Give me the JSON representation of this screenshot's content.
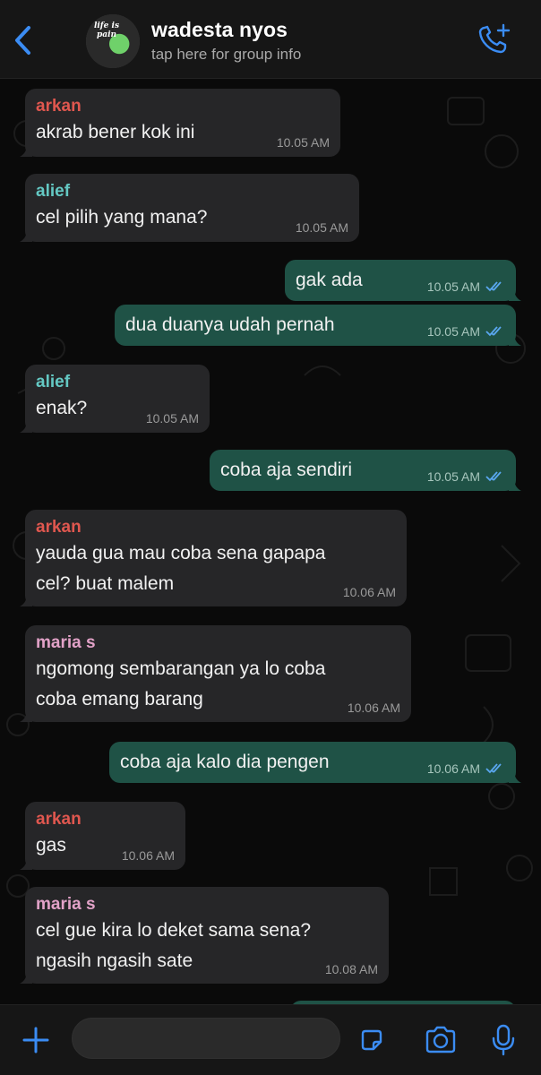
{
  "header": {
    "group_name": "wadesta nyos",
    "subtitle": "tap here for group info",
    "avatar_text": "life is pain",
    "accent": "#3b8cf3"
  },
  "messages": [
    {
      "sender": "arkan",
      "sender_color": "#e0574f",
      "lines": [
        "akrab bener kok ini"
      ],
      "time": "10.05 AM",
      "out": false
    },
    {
      "sender": "alief",
      "sender_color": "#64c8c3",
      "lines": [
        "cel pilih yang mana?"
      ],
      "time": "10.05 AM",
      "out": false
    },
    {
      "sender": "",
      "lines": [
        "gak ada"
      ],
      "time": "10.05 AM",
      "out": true
    },
    {
      "sender": "",
      "lines": [
        "dua duanya udah pernah"
      ],
      "time": "10.05 AM",
      "out": true
    },
    {
      "sender": "alief",
      "sender_color": "#64c8c3",
      "lines": [
        "enak?"
      ],
      "time": "10.05 AM",
      "out": false
    },
    {
      "sender": "",
      "lines": [
        "coba aja sendiri"
      ],
      "time": "10.05 AM",
      "out": true
    },
    {
      "sender": "arkan",
      "sender_color": "#e0574f",
      "lines": [
        "yauda gua mau coba sena gapapa",
        "cel? buat malem"
      ],
      "time": "10.06 AM",
      "out": false
    },
    {
      "sender": "maria s",
      "sender_color": "#e2a2c8",
      "lines": [
        "ngomong sembarangan ya lo coba",
        "coba emang barang"
      ],
      "time": "10.06 AM",
      "out": false
    },
    {
      "sender": "",
      "lines": [
        "coba aja kalo dia pengen"
      ],
      "time": "10.06 AM",
      "out": true
    },
    {
      "sender": "arkan",
      "sender_color": "#e0574f",
      "lines": [
        "gas"
      ],
      "time": "10.06 AM",
      "out": false
    },
    {
      "sender": "maria s",
      "sender_color": "#e2a2c8",
      "lines": [
        "cel gue kira lo deket sama sena?",
        "ngasih ngasih sate"
      ],
      "time": "10.08 AM",
      "out": false
    }
  ],
  "input": {
    "placeholder": ""
  },
  "icons": {
    "back": "chevron-left-icon",
    "call": "add-call-icon",
    "plus": "plus-icon",
    "sticker": "sticker-icon",
    "camera": "camera-icon",
    "mic": "microphone-icon"
  }
}
